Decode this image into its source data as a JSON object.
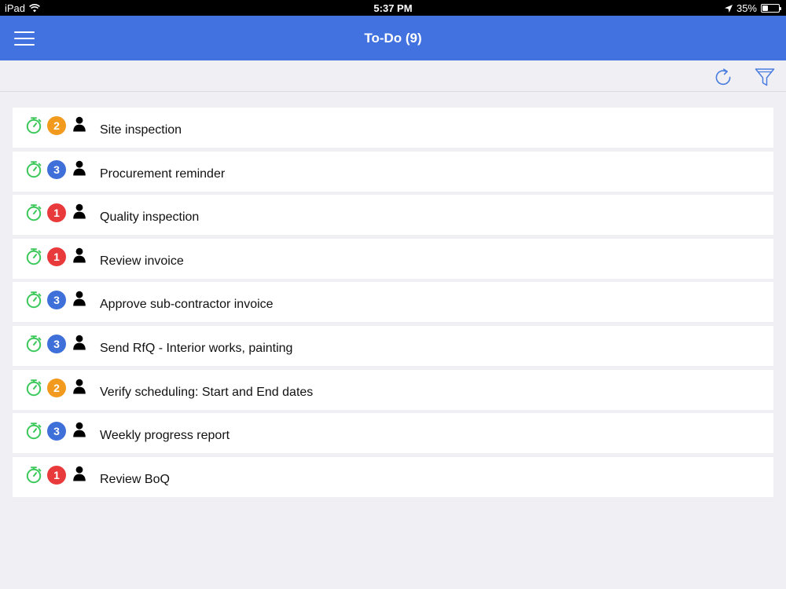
{
  "status_bar": {
    "device": "iPad",
    "time": "5:37 PM",
    "battery": "35%",
    "battery_level": 0.35
  },
  "nav": {
    "title": "To-Do (9)"
  },
  "colors": {
    "nav_bg": "#4272e0",
    "timer_green": "#3cc85a",
    "toolbar_blue": "#4a7de0",
    "priority_1": "#e83a3a",
    "priority_2": "#f29a1d",
    "priority_3": "#3f6fd9"
  },
  "icons": {
    "menu": "hamburger-icon",
    "refresh": "refresh-icon",
    "filter": "filter-icon",
    "timer": "stopwatch-icon",
    "assignee": "person-icon"
  },
  "tasks": [
    {
      "priority": "2",
      "title": "Site inspection"
    },
    {
      "priority": "3",
      "title": "Procurement reminder"
    },
    {
      "priority": "1",
      "title": "Quality inspection"
    },
    {
      "priority": "1",
      "title": "Review invoice"
    },
    {
      "priority": "3",
      "title": "Approve sub-contractor invoice"
    },
    {
      "priority": "3",
      "title": "Send RfQ - Interior works, painting"
    },
    {
      "priority": "2",
      "title": "Verify scheduling: Start and End dates"
    },
    {
      "priority": "3",
      "title": "Weekly progress report"
    },
    {
      "priority": "1",
      "title": "Review BoQ"
    }
  ]
}
